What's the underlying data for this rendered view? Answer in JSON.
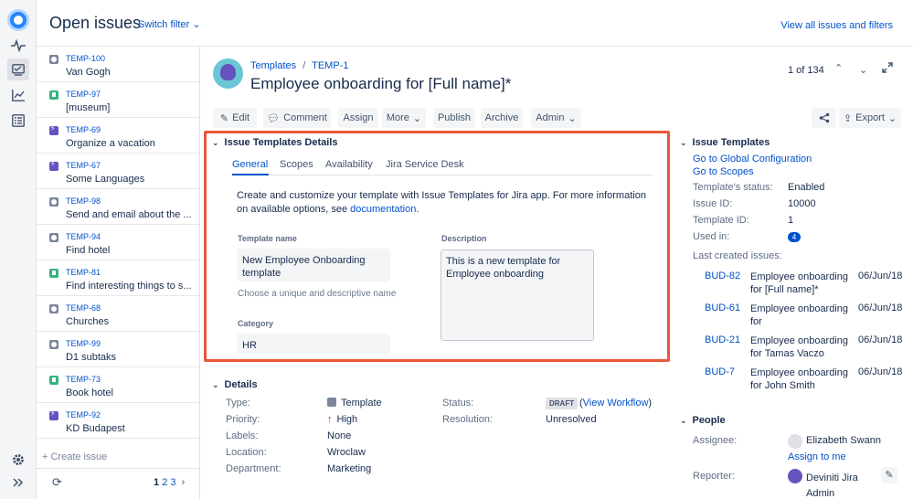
{
  "header": {
    "title": "Open issues",
    "switch_filter": "Switch filter",
    "view_all": "View all issues and filters"
  },
  "issues": [
    {
      "type": "task",
      "key": "TEMP-100",
      "summary": "Van Gogh"
    },
    {
      "type": "story",
      "key": "TEMP-97",
      "summary": "[museum]"
    },
    {
      "type": "epic",
      "key": "TEMP-69",
      "summary": "Organize a vacation"
    },
    {
      "type": "epic",
      "key": "TEMP-67",
      "summary": "Some Languages"
    },
    {
      "type": "task",
      "key": "TEMP-98",
      "summary": "Send and email about the ..."
    },
    {
      "type": "task",
      "key": "TEMP-94",
      "summary": "Find hotel"
    },
    {
      "type": "story",
      "key": "TEMP-81",
      "summary": "Find interesting things to s..."
    },
    {
      "type": "task",
      "key": "TEMP-68",
      "summary": "Churches"
    },
    {
      "type": "task",
      "key": "TEMP-99",
      "summary": "D1 subtaks"
    },
    {
      "type": "story",
      "key": "TEMP-73",
      "summary": "Book hotel"
    },
    {
      "type": "epic",
      "key": "TEMP-92",
      "summary": "KD Budapest"
    }
  ],
  "list_footer": {
    "create_issue": "+ Create issue",
    "pages": [
      "1",
      "2",
      "3"
    ],
    "next": "›"
  },
  "issue": {
    "breadcrumb_project": "Templates",
    "breadcrumb_sep": "/",
    "breadcrumb_key": "TEMP-1",
    "title": "Employee onboarding for [Full name]*",
    "position": "1 of 134"
  },
  "toolbar": {
    "edit": "Edit",
    "comment": "Comment",
    "assign": "Assign",
    "more": "More",
    "publish": "Publish",
    "archive": "Archive",
    "admin": "Admin",
    "export": "Export"
  },
  "templates_panel": {
    "heading": "Issue Templates Details",
    "tabs": [
      "General",
      "Scopes",
      "Availability",
      "Jira Service Desk"
    ],
    "intro": "Create and customize your template with Issue Templates for Jira app. For more information on available options, see ",
    "intro_link": "documentation",
    "intro_end": ".",
    "template_name_label": "Template name",
    "template_name_value": "New Employee Onboarding template",
    "template_name_help": "Choose a unique and descriptive name",
    "description_label": "Description",
    "description_value": "This is a new template for Employee onboarding",
    "category_label": "Category",
    "category_value": "HR"
  },
  "details": {
    "heading": "Details",
    "type_label": "Type:",
    "type_value": "Template",
    "priority_label": "Priority:",
    "priority_value": "High",
    "labels_label": "Labels:",
    "labels_value": "None",
    "location_label": "Location:",
    "location_value": "Wroclaw",
    "department_label": "Department:",
    "department_value": "Marketing",
    "status_label": "Status:",
    "status_value": "DRAFT",
    "view_workflow": "View Workflow",
    "resolution_label": "Resolution:",
    "resolution_value": "Unresolved"
  },
  "issue_templates": {
    "heading": "Issue Templates",
    "global_config": "Go to Global Configuration",
    "go_scopes": "Go to Scopes",
    "status_label": "Template's status:",
    "status_value": "Enabled",
    "issue_id_label": "Issue ID:",
    "issue_id_value": "10000",
    "template_id_label": "Template ID:",
    "template_id_value": "1",
    "used_in_label": "Used in:",
    "used_in_value": "4",
    "last_created_label": "Last created issues:",
    "last_created": [
      {
        "key": "BUD-82",
        "summary": "Employee onboarding for [Full name]*",
        "date": "06/Jun/18"
      },
      {
        "key": "BUD-61",
        "summary": "Employee onboarding for",
        "date": "06/Jun/18"
      },
      {
        "key": "BUD-21",
        "summary": "Employee onboarding for Tamas Vaczo",
        "date": "06/Jun/18"
      },
      {
        "key": "BUD-7",
        "summary": "Employee onboarding for John Smith",
        "date": "06/Jun/18"
      }
    ]
  },
  "people": {
    "heading": "People",
    "assignee_label": "Assignee:",
    "assignee_value": "Elizabeth Swann",
    "assign_to_me": "Assign to me",
    "reporter_label": "Reporter:",
    "reporter_value": "Deviniti Jira Admin"
  },
  "colors": {
    "accent": "#0052cc",
    "highlight_border": "#e8573a",
    "story": "#36b37e",
    "epic": "#6554c0",
    "task": "#7a869a"
  }
}
